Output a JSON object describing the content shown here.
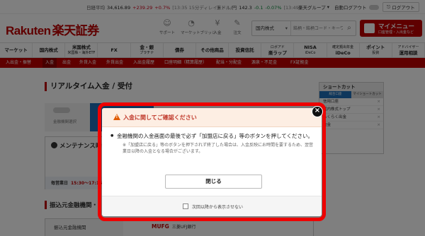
{
  "ticker": {
    "nikkei_label": "日経平均",
    "nikkei_value": "34,616.89",
    "nikkei_change": "+239.29",
    "nikkei_pct": "+0.7%",
    "nikkei_time": "[13:35 15分ディレイ]",
    "fx_label": "米ドル/円",
    "fx_value": "142.3",
    "fx_change": "-0.1",
    "fx_pct": "-0.07%",
    "fx_time": "[13:49]",
    "group_label": "楽天グループ",
    "auto_logout": "自動ログアウト",
    "logout": "ログアウト"
  },
  "header": {
    "logo_en": "Rakuten",
    "logo_ja": "楽天証券",
    "icons": [
      {
        "name": "support-icon",
        "label": "サポート",
        "glyph": "☺"
      },
      {
        "name": "market-bridge-icon",
        "label": "マーケットブリッジ",
        "glyph": "◔"
      },
      {
        "name": "deposit-icon",
        "label": "入金",
        "glyph": "¥"
      },
      {
        "name": "order-icon",
        "label": "注文",
        "glyph": "✎"
      }
    ],
    "search_category": "国内株式",
    "search_placeholder": "銘柄・銘柄コード・キーワード",
    "mymenu_title": "マイメニュー",
    "mymenu_sub": "口座管理・入出金など"
  },
  "gnav": [
    {
      "label": "マーケット",
      "sub": ""
    },
    {
      "label": "国内株式",
      "sub": ""
    },
    {
      "label": "米国株式",
      "sub": "米国株・海外ETF"
    },
    {
      "label": "FX",
      "sub": ""
    },
    {
      "label": "金・銀",
      "sub": "プラチナ"
    },
    {
      "label": "債券",
      "sub": ""
    },
    {
      "label": "その他商品",
      "sub": ""
    },
    {
      "label": "投資信託",
      "sub": ""
    },
    {
      "label": "楽ラップ",
      "sub": "ロボアド"
    },
    {
      "label": "NISA",
      "sub": "iDeCo"
    },
    {
      "label": "確定拠出年金",
      "sub": "iDeCo"
    },
    {
      "label": "ポイント",
      "sub": "投資"
    },
    {
      "label": "アドバイザー",
      "sub": "運用相談"
    }
  ],
  "snav": [
    "入出金・振替",
    "入金",
    "出金",
    "外貨入金",
    "外貨出金",
    "入出金履歴",
    "口座明細（精算履歴）",
    "配当・分配金",
    "源泉・不足金",
    "FX証拠金"
  ],
  "page": {
    "title": "リアルタイム入金 / 受付",
    "step1_label": "金融機関選択",
    "maintenance_title": "メンテナンス時間",
    "maint_day": "毎営業日",
    "maint_time": "15:30～17:15",
    "section2": "振込元金融機関・",
    "table_header": "振込元金融機関",
    "bank_name": "MUFG",
    "bank_sub": "三菱UFJ銀行"
  },
  "shortcut": {
    "title": "ショートカット",
    "tabs": [
      "総合口座",
      "マイショートカット"
    ],
    "items": [
      "信用口座",
      "国内株式トップ",
      "らくらく出金",
      "信金"
    ]
  },
  "modal": {
    "title": "入金に関してご確認ください",
    "bullet": "金融機関の入金画面の最後で必ず「加盟店に戻る」等のボタンを押してください。",
    "note": "※「加盟店に戻る」等のボタンを押下されず終了した場合は、入金反映にお時間を要するため、翌営業日以降の入金となる場合がございます。",
    "close_button": "閉じる",
    "checkbox_label": "次回以降から表示させない"
  }
}
